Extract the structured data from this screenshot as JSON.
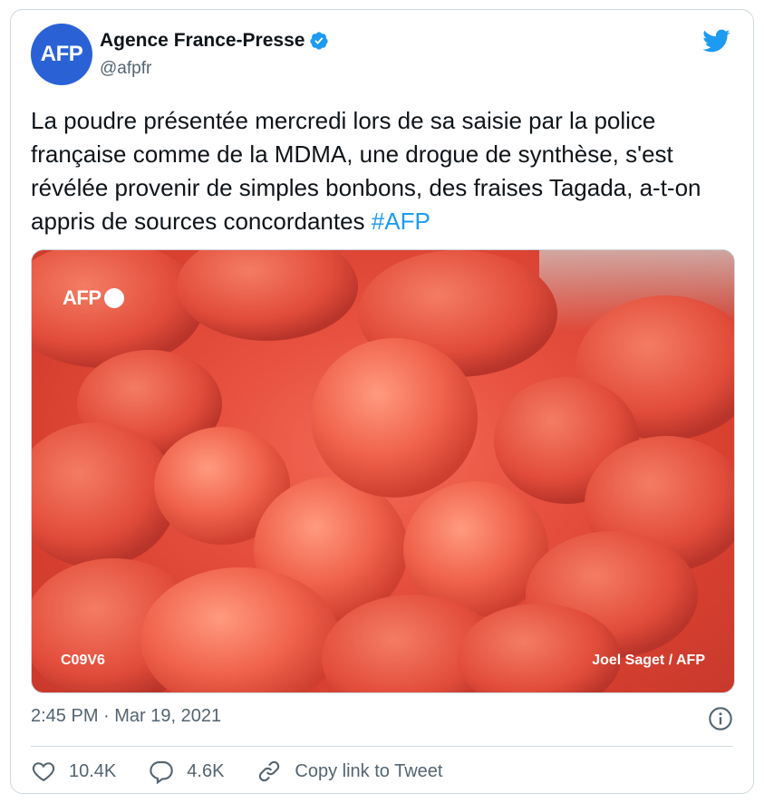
{
  "author": {
    "avatar_text": "AFP",
    "name": "Agence France-Presse",
    "handle": "@afpfr"
  },
  "tweet": {
    "text": "La poudre présentée mercredi lors de sa saisie par la police française comme de la MDMA, une drogue de synthèse, s'est révélée provenir de simples bonbons, des fraises Tagada, a-t-on appris de sources concordantes ",
    "hashtag": "#AFP"
  },
  "photo": {
    "watermark": "AFP",
    "code": "C09V6",
    "credit": "Joel Saget / AFP"
  },
  "meta": {
    "timestamp": "2:45 PM · Mar 19, 2021"
  },
  "actions": {
    "likes": "10.4K",
    "replies": "4.6K",
    "copy_link": "Copy link to Tweet"
  },
  "colors": {
    "accent": "#1d9bf0",
    "avatar_bg": "#2a62d6",
    "muted_text": "#536471",
    "border": "#cfd9de"
  }
}
